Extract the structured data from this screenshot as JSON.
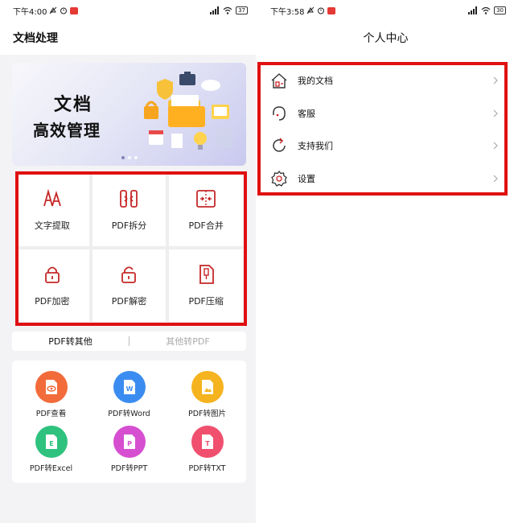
{
  "left": {
    "status": {
      "time": "下午4:00",
      "battery": "37"
    },
    "title": "文档处理",
    "banner": {
      "line1": "文档",
      "line2": "高效管理"
    },
    "tools": [
      {
        "label": "文字提取",
        "icon": "text-extract-icon"
      },
      {
        "label": "PDF拆分",
        "icon": "split-icon"
      },
      {
        "label": "PDF合并",
        "icon": "merge-icon"
      },
      {
        "label": "PDF加密",
        "icon": "lock-icon"
      },
      {
        "label": "PDF解密",
        "icon": "unlock-icon"
      },
      {
        "label": "PDF压缩",
        "icon": "compress-icon"
      }
    ],
    "tabs": [
      "PDF转其他",
      "其他转PDF"
    ],
    "convert": [
      {
        "label": "PDF查看",
        "icon": "eye-file-icon",
        "color": "#f26b3a",
        "glyph": ""
      },
      {
        "label": "PDF转Word",
        "icon": "word-file-icon",
        "color": "#3b8cf0",
        "glyph": "W"
      },
      {
        "label": "PDF转图片",
        "icon": "image-file-icon",
        "color": "#f5b31f",
        "glyph": ""
      },
      {
        "label": "PDF转Excel",
        "icon": "excel-file-icon",
        "color": "#2ec27e",
        "glyph": "E"
      },
      {
        "label": "PDF转PPT",
        "icon": "ppt-file-icon",
        "color": "#d64fd0",
        "glyph": "P"
      },
      {
        "label": "PDF转TXT",
        "icon": "txt-file-icon",
        "color": "#f0506e",
        "glyph": "T"
      }
    ]
  },
  "right": {
    "status": {
      "time": "下午3:58",
      "battery": "30"
    },
    "title": "个人中心",
    "menu": [
      {
        "label": "我的文档",
        "icon": "home-doc-icon"
      },
      {
        "label": "客服",
        "icon": "headset-icon"
      },
      {
        "label": "支持我们",
        "icon": "refresh-heart-icon"
      },
      {
        "label": "设置",
        "icon": "gear-icon"
      }
    ]
  },
  "colors": {
    "highlight": "#e01010",
    "accent": "#cc2222"
  }
}
